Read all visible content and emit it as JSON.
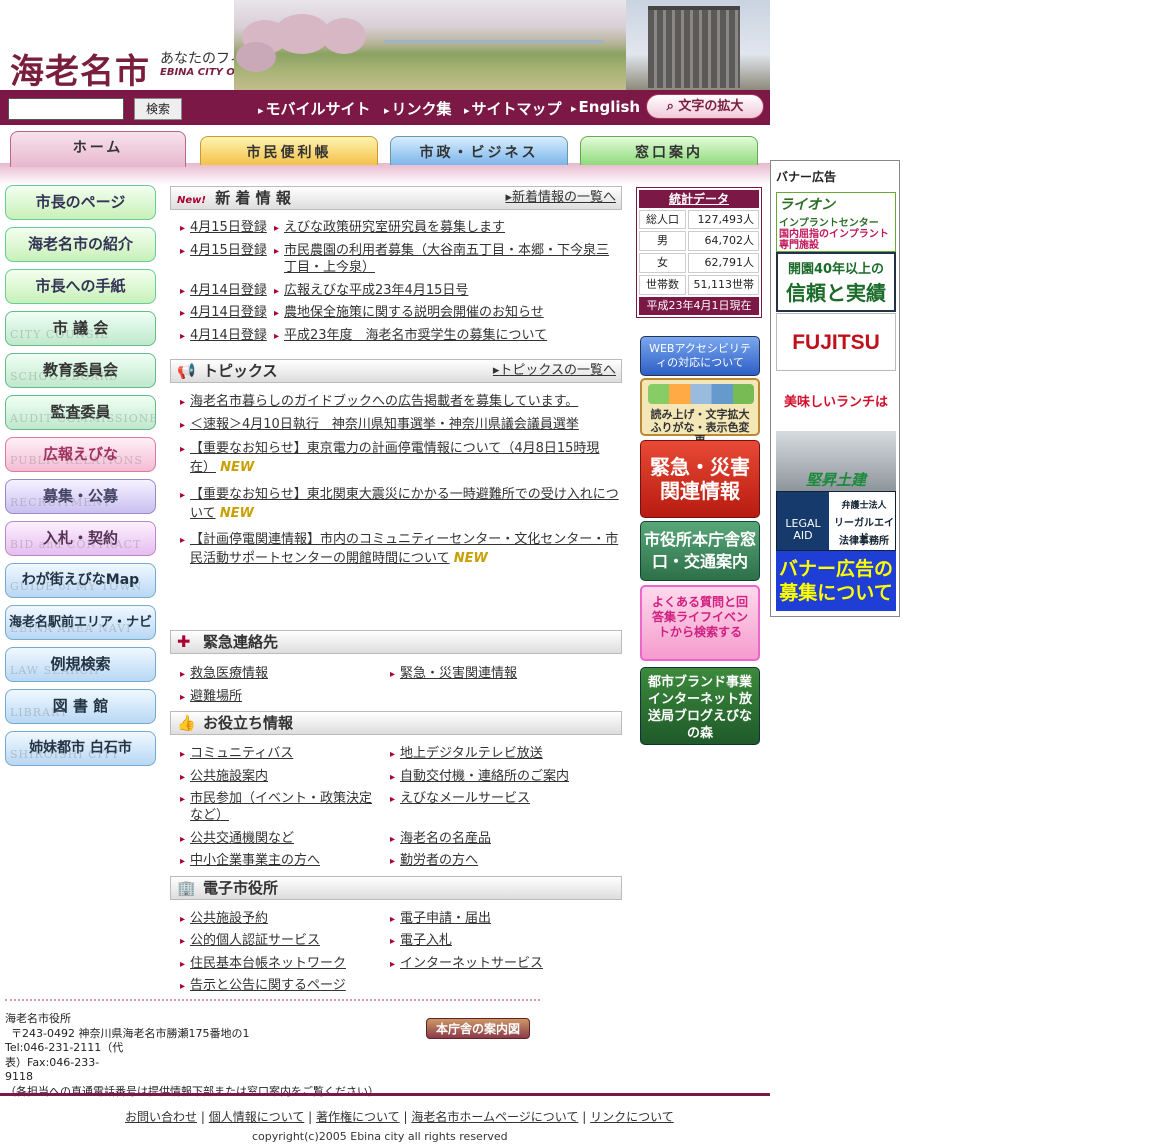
{
  "header": {
    "logo": "海老名市",
    "tagline": "あなたのフィールドへ。海老名市",
    "tagline_en": "EBINA CITY Official Web Site"
  },
  "search": {
    "placeholder": "",
    "button_label": "検索"
  },
  "top_links": [
    "モバイルサイト",
    "リンク集",
    "サイトマップ",
    "English"
  ],
  "zoom_button": "文字の拡大",
  "tabs": [
    "ホーム",
    "市民便利帳",
    "市政・ビジネス",
    "窓口案内"
  ],
  "left_menu": [
    {
      "label": "市長のページ",
      "sub": ""
    },
    {
      "label": "海老名市の紹介",
      "sub": ""
    },
    {
      "label": "市長への手紙",
      "sub": ""
    },
    {
      "label": "市 議 会",
      "sub": "CITY COUNSIL"
    },
    {
      "label": "教育委員会",
      "sub": "SCHOOL BOARD"
    },
    {
      "label": "監査委員",
      "sub": "AUDIT COMMISSIONER"
    },
    {
      "label": "広報えびな",
      "sub": "PUBLIC RELATIONS"
    },
    {
      "label": "募集・公募",
      "sub": "RECRUITMENT"
    },
    {
      "label": "入札・契約",
      "sub": "BID and CONTRACT"
    },
    {
      "label": "わが街えびなMap",
      "sub": "GUIDE of MY TOWN"
    },
    {
      "label": "海老名駅前エリア・ナビ",
      "sub": "EBINA AREA NAVI"
    },
    {
      "label": "例規検索",
      "sub": "LAW SEARCH"
    },
    {
      "label": "図 書 館",
      "sub": "LIBRARY"
    },
    {
      "label": "姉妹都市 白石市",
      "sub": "SHIROISHI CITY"
    }
  ],
  "news": {
    "new_badge": "New!",
    "title": "新 着 情 報",
    "more": "新着情報の一覧へ",
    "items": [
      {
        "date": "4月15日登録",
        "text": "えびな政策研究室研究員を募集します"
      },
      {
        "date": "4月15日登録",
        "text": "市民農園の利用者募集（大谷南五丁目・本郷・下今泉三丁目・上今泉）"
      },
      {
        "date": "4月14日登録",
        "text": "広報えびな平成23年4月15日号"
      },
      {
        "date": "4月14日登録",
        "text": "農地保全施策に関する説明会開催のお知らせ"
      },
      {
        "date": "4月14日登録",
        "text": "平成23年度　海老名市奨学生の募集について"
      }
    ]
  },
  "topics": {
    "title": "トピックス",
    "more": "トピックスの一覧へ",
    "new_label": "NEW",
    "items": [
      {
        "text": "海老名市暮らしのガイドブックへの広告掲載者を募集しています。"
      },
      {
        "text": "＜速報＞4月10日執行　神奈川県知事選挙・神奈川県議会議員選挙"
      },
      {
        "text": "【重要なお知らせ】東京電力の計画停電情報について（4月8日15時現在）"
      },
      {
        "text": "【重要なお知らせ】東北関東大震災にかかる一時避難所での受け入れについて"
      },
      {
        "text": "【計画停電関連情報】市内のコミュニティーセンター・文化センター・市民活動サポートセンターの開館時間について"
      }
    ]
  },
  "emergency": {
    "title": "緊急連絡先",
    "links": [
      "救急医療情報",
      "緊急・災害関連情報",
      "避難場所"
    ]
  },
  "useful": {
    "title": "お役立ち情報",
    "links": [
      "コミュニティバス",
      "地上デジタルテレビ放送",
      "公共施設案内",
      "自動交付機・連絡所のご案内",
      "市民参加（イベント・政策決定など）",
      "えびなメールサービス",
      "公共交通機関など",
      "海老名の名産品",
      "中小企業事業主の方へ",
      "勤労者の方へ"
    ]
  },
  "ecity": {
    "title": "電子市役所",
    "links": [
      "公共施設予約",
      "電子申請・届出",
      "公的個人認証サービス",
      "電子入札",
      "住民基本台帳ネットワーク",
      "インターネットサービス",
      "告示と公告に関するページ"
    ]
  },
  "stats": {
    "title": "統計データ",
    "rows": [
      {
        "label": "総人口",
        "value": "127,493人"
      },
      {
        "label": "男",
        "value": "64,702人"
      },
      {
        "label": "女",
        "value": "62,791人"
      },
      {
        "label": "世帯数",
        "value": "51,113世帯"
      }
    ],
    "as_of": "平成23年4月1日現在"
  },
  "right_buttons": {
    "accessibility": "WEBアクセシビリティの対応について",
    "read_aloud": "読み上げ・文字拡大ふりがな・表示色変更",
    "disaster": "緊急・災害関連情報",
    "cityhall": "市役所本庁舎窓口・交通案内",
    "faq": "よくある質問と回答集ライフイベントから検索する",
    "blog": "都市ブランド事業インターネット放送局ブログえびなの森"
  },
  "banners": {
    "title": "バナー広告",
    "lion_1": "ライオン",
    "lion_2": "インプラントセンター",
    "lion_3": "国内屈指のインプラント専門施設",
    "trust_1": "開園40年以上の",
    "trust_2": "信頼と実績",
    "fujitsu": "FUJITSU",
    "lunch": "美味しいランチは",
    "kensetsu": "堅昇土建",
    "legal_1": "LEGAL AID",
    "legal_2": "弁護士法人",
    "legal_3": "リーガルエイド",
    "legal_4": "法律事務所",
    "recruit_1": "バナー広告の",
    "recruit_2": "募集について"
  },
  "footer": {
    "org": "海老名市役所",
    "address": "〒243-0492 神奈川県海老名市勝瀬175番地の1",
    "tel": "Tel:046-231-2111（代表）Fax:046-233-9118",
    "note": "（各担当への直通電話番号は提供情報下部または窓口案内をご覧ください）",
    "guide_button": "本庁舎の案内図",
    "links": [
      "お問い合わせ",
      "個人情報について",
      "著作権について",
      "海老名市ホームページについて",
      "リンクについて"
    ],
    "copyright": "copyright(c)2005 Ebina city all rights reserved"
  }
}
